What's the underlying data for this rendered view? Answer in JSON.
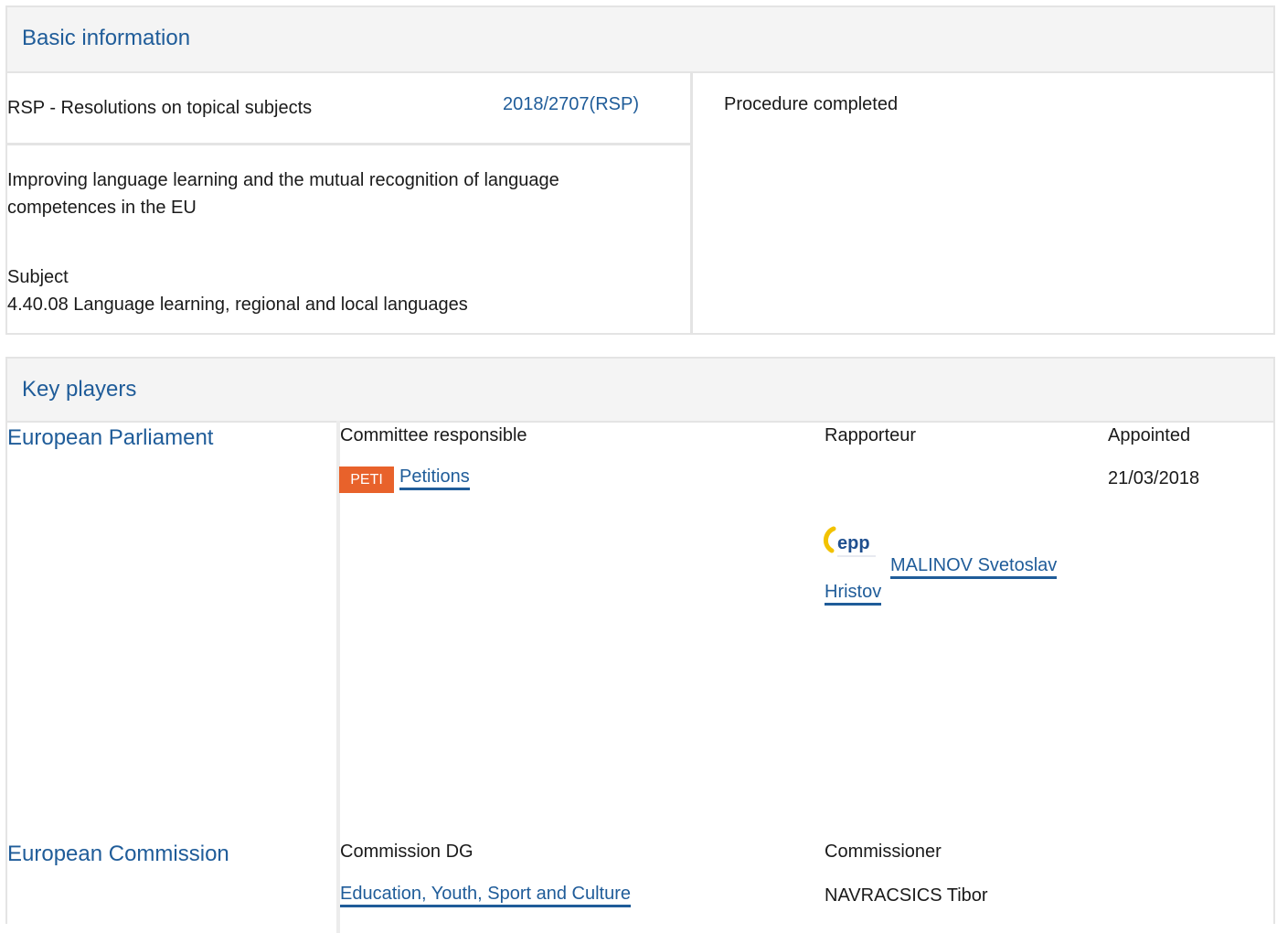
{
  "basic": {
    "title": "Basic information",
    "procedure_type": "RSP - Resolutions on topical subjects",
    "reference": "2018/2707(RSP)",
    "status": "Procedure completed",
    "description": "Improving language learning and the mutual recognition of language competences in the EU",
    "subject_label": "Subject",
    "subject_value": "4.40.08 Language learning, regional and local languages"
  },
  "players": {
    "title": "Key players",
    "ep": {
      "name": "European Parliament",
      "committee_header": "Committee responsible",
      "rapporteur_header": "Rapporteur",
      "appointed_header": "Appointed",
      "committee_code": "PETI",
      "committee_name": "Petitions",
      "party_logo_text": "epp",
      "rapporteur_name_line1": "MALINOV Svetoslav",
      "rapporteur_name_line2": "Hristov",
      "appointed_date": "21/03/2018"
    },
    "ec": {
      "name": "European Commission",
      "dg_header": "Commission DG",
      "commissioner_header": "Commissioner",
      "dg_name": "Education, Youth, Sport and Culture",
      "commissioner_name": "NAVRACSICS Tibor"
    }
  },
  "colors": {
    "accent": "#1f5c99",
    "badge": "#e8622b",
    "border": "#e4e4e4",
    "header_bg": "#f4f4f4",
    "party_logo": "#1f4f8f",
    "party_logo_swoosh": "#f2c200"
  }
}
